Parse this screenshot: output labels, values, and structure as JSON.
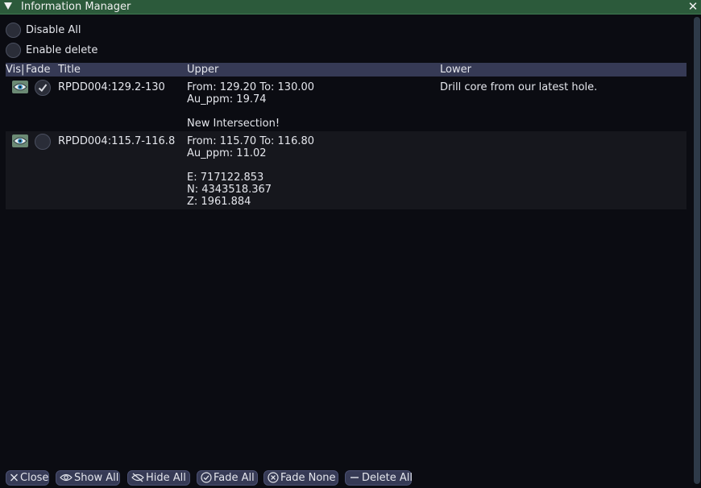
{
  "window": {
    "title": "Information Manager",
    "close_glyph": "✕"
  },
  "options": {
    "disable_all": "Disable All",
    "enable_delete": "Enable delete"
  },
  "table": {
    "headers": {
      "vis": "Vis|",
      "fade": "Fade",
      "title": "Title",
      "upper": "Upper",
      "lower": "Lower"
    },
    "rows": [
      {
        "title": "RPDD004:129.2-130",
        "upper": "From: 129.20 To: 130.00\nAu_ppm: 19.74\n\nNew Intersection!",
        "lower": "Drill core from our latest hole.",
        "visible": true,
        "fade": true
      },
      {
        "title": "RPDD004:115.7-116.8",
        "upper": "From: 115.70 To: 116.80\nAu_ppm: 11.02\n\nE: 717122.853\nN: 4343518.367\nZ: 1961.884",
        "lower": "",
        "visible": true,
        "fade": false
      }
    ]
  },
  "footer": {
    "close": "Close",
    "show_all": "Show All",
    "hide_all": "Hide All",
    "fade_all": "Fade All",
    "fade_none": "Fade None",
    "delete_all": "Delete All"
  },
  "icons": {
    "vis": "eye-icon",
    "fade": "checkmark-icon",
    "close": "x-icon",
    "show_all": "eye-outline-icon",
    "hide_all": "eye-slash-icon",
    "fade_all": "check-circle-icon",
    "fade_none": "x-circle-icon",
    "delete_all": "minus-icon"
  },
  "colors": {
    "titlebar": "#2c5a3b",
    "header": "#363a55",
    "background": "#0b0c12",
    "button": "#363a55",
    "vis_icon_bg": "#6b8a74"
  }
}
